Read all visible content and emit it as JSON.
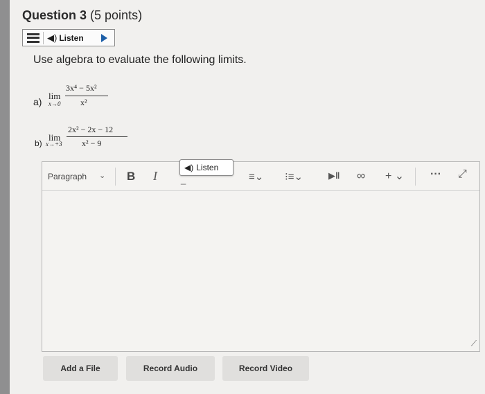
{
  "question": {
    "title": "Question 3",
    "points": "(5 points)",
    "instruction": "Use algebra to evaluate the following limits."
  },
  "listen_bar": {
    "label": "Listen"
  },
  "problems": [
    {
      "label": "a)",
      "lim": "lim",
      "approach": "x→0",
      "numerator": "3x⁴ − 5x²",
      "denominator": "x²"
    },
    {
      "label": "b)",
      "lim": "lim",
      "approach": "x→+3",
      "numerator": "2x² − 2x − 12",
      "denominator": "x² − 9"
    }
  ],
  "editor": {
    "paragraph_label": "Paragraph",
    "bold_label": "B",
    "italic_label": "I",
    "listen_popup_label": "Listen"
  },
  "buttons": {
    "add_file": "Add a File",
    "record_audio": "Record Audio",
    "record_video": "Record Video"
  },
  "colors": {
    "play_accent": "#1d5fa8"
  }
}
